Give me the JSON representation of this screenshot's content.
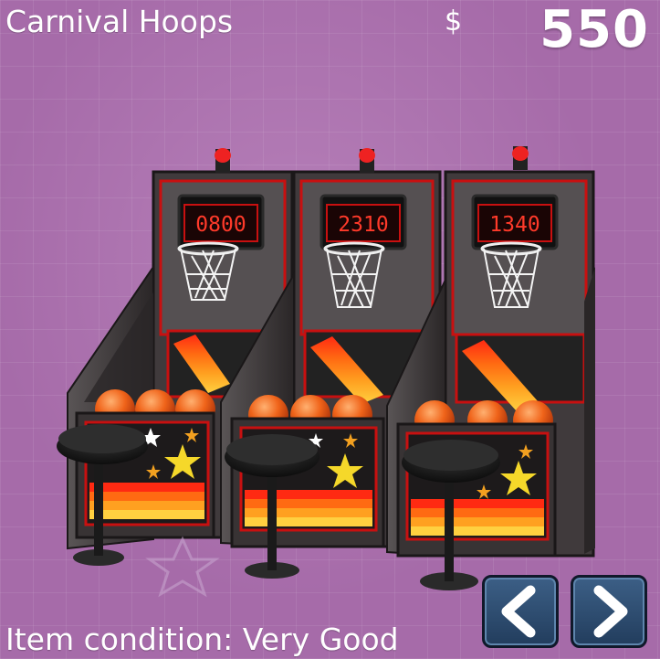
{
  "game": {
    "title": "Carnival Hoops",
    "currency_symbol": "$",
    "money": "550",
    "condition_text": "Item condition: Very Good"
  },
  "machines": [
    {
      "score": "0800"
    },
    {
      "score": "2310"
    },
    {
      "score": "1340"
    }
  ],
  "nav": {
    "prev_icon": "chevron-left-icon",
    "next_icon": "chevron-right-icon"
  },
  "colors": {
    "background": "#a66ba9",
    "cabinet": "#3a3537",
    "neon": "#e01010",
    "score_digits": "#ff3a2a",
    "ball": "#f0641a",
    "nav_button": "#2c4b70"
  }
}
